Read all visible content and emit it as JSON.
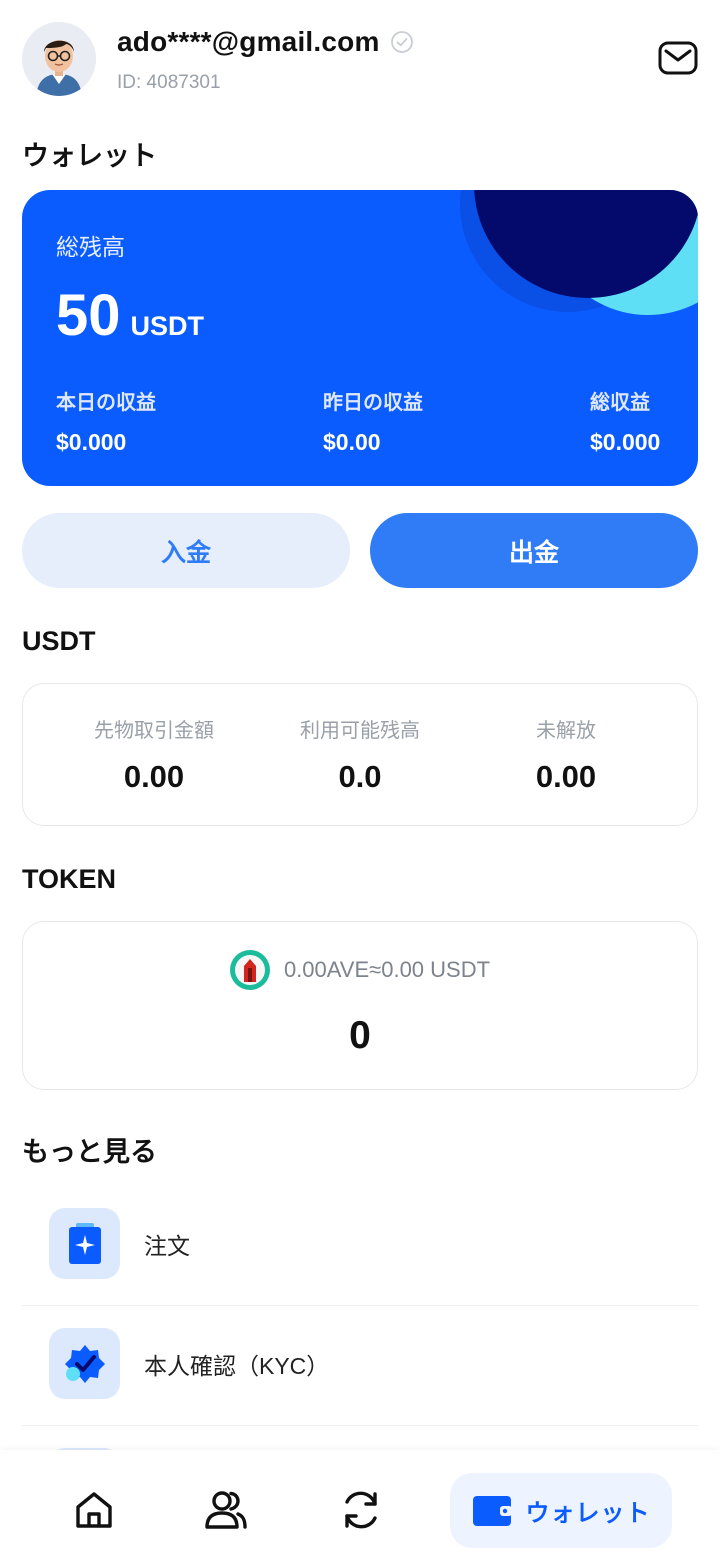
{
  "header": {
    "email": "ado****@gmail.com",
    "user_id": "ID: 4087301"
  },
  "wallet": {
    "section_title": "ウォレット",
    "total_label": "総残高",
    "total_value": "50",
    "total_unit": "USDT",
    "stats": [
      {
        "label": "本日の収益",
        "value": "$0.000"
      },
      {
        "label": "昨日の収益",
        "value": "$0.00"
      },
      {
        "label": "総収益",
        "value": "$0.000"
      }
    ],
    "deposit_label": "入金",
    "withdraw_label": "出金"
  },
  "usdt": {
    "section_title": "USDT",
    "columns": [
      {
        "label": "先物取引金額",
        "value": "0.00"
      },
      {
        "label": "利用可能残高",
        "value": "0.0"
      },
      {
        "label": "未解放",
        "value": "0.00"
      }
    ]
  },
  "token": {
    "section_title": "TOKEN",
    "conversion": "0.00AVE≈0.00 USDT",
    "amount": "0"
  },
  "more": {
    "section_title": "もっと見る",
    "items": [
      {
        "label": "注文",
        "icon": "order-icon"
      },
      {
        "label": "本人確認（KYC）",
        "icon": "kyc-badge-icon"
      }
    ]
  },
  "nav": {
    "items": [
      {
        "icon": "home-icon"
      },
      {
        "icon": "users-icon"
      },
      {
        "icon": "refresh-icon"
      },
      {
        "icon": "wallet-icon",
        "label": "ウォレット",
        "active": true
      }
    ]
  },
  "colors": {
    "primary": "#0b5cff",
    "button_blue": "#2f7cf6",
    "deposit_bg": "#e6eefb",
    "deco_dark": "#040a6b",
    "deco_light": "#5fdff6"
  }
}
